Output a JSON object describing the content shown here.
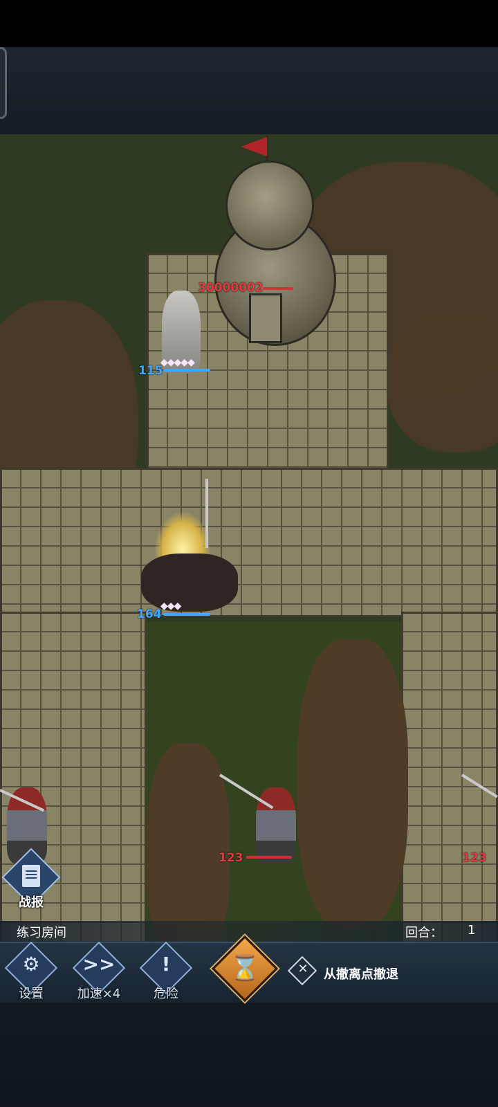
{
  "battle": {
    "room_name": "练习房间",
    "round_label": "回合：",
    "round_value": "1",
    "report_label": "战报"
  },
  "units": {
    "tower_hp": "30000002",
    "bard_hp": "115",
    "knight_hp": "164",
    "enemy_left_hp": "123",
    "enemy_center_hp": "123",
    "enemy_right_hp": "123"
  },
  "controls": {
    "settings_label": "设置",
    "speed_label": "加速×4",
    "speed_glyph": ">>",
    "danger_label": "危险",
    "danger_glyph": "!",
    "end_turn_glyph": "⌛",
    "retreat_label": "从撤离点撤退"
  },
  "colors": {
    "ally_hp": "#3fa9ff",
    "enemy_hp": "#e1393f",
    "end_turn_accent": "#e0902e"
  }
}
